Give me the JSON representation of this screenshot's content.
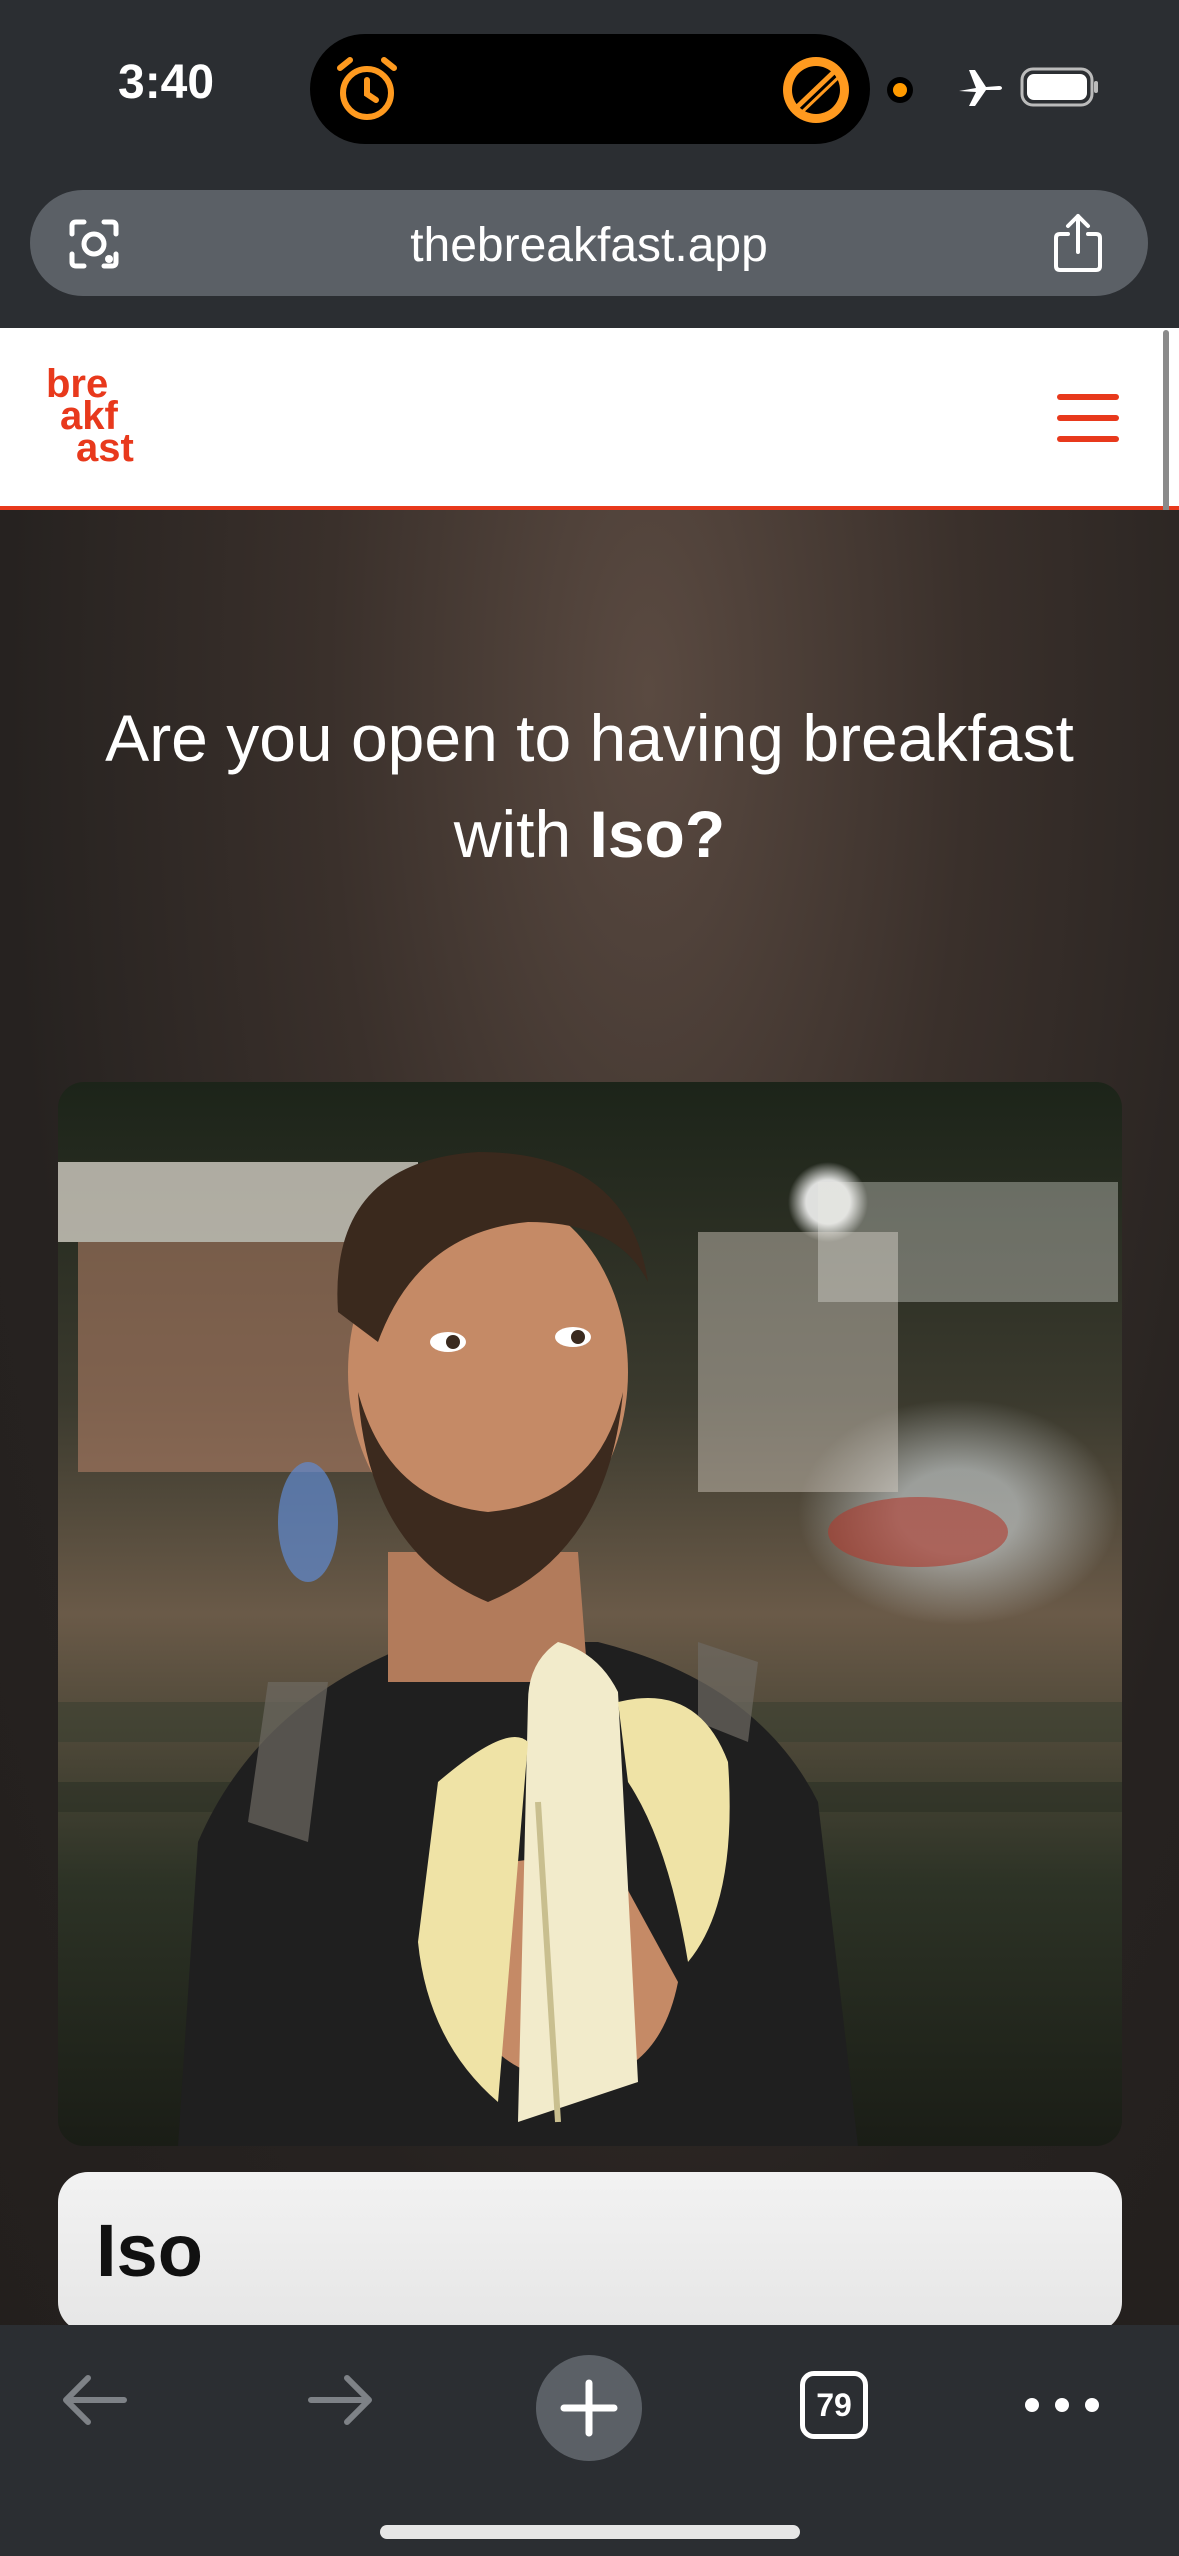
{
  "status": {
    "time": "3:40"
  },
  "browser": {
    "url": "thebreakfast.app",
    "tab_count": "79"
  },
  "site": {
    "logo_lines": [
      "bre",
      "akf",
      "ast"
    ],
    "question_prefix": "Are you open to having breakfast with ",
    "question_name": "Iso?",
    "profile_name": "Iso",
    "brand_color": "#e8391c"
  },
  "icons": {
    "status": [
      "alarm-icon",
      "timer-icon",
      "recording-dot-icon",
      "airplane-icon",
      "battery-icon"
    ],
    "url_bar": [
      "lens-icon",
      "share-icon"
    ],
    "header": [
      "hamburger-menu-icon"
    ],
    "toolbar": [
      "back-arrow-icon",
      "forward-arrow-icon",
      "plus-icon",
      "tabs-icon",
      "more-icon"
    ]
  }
}
